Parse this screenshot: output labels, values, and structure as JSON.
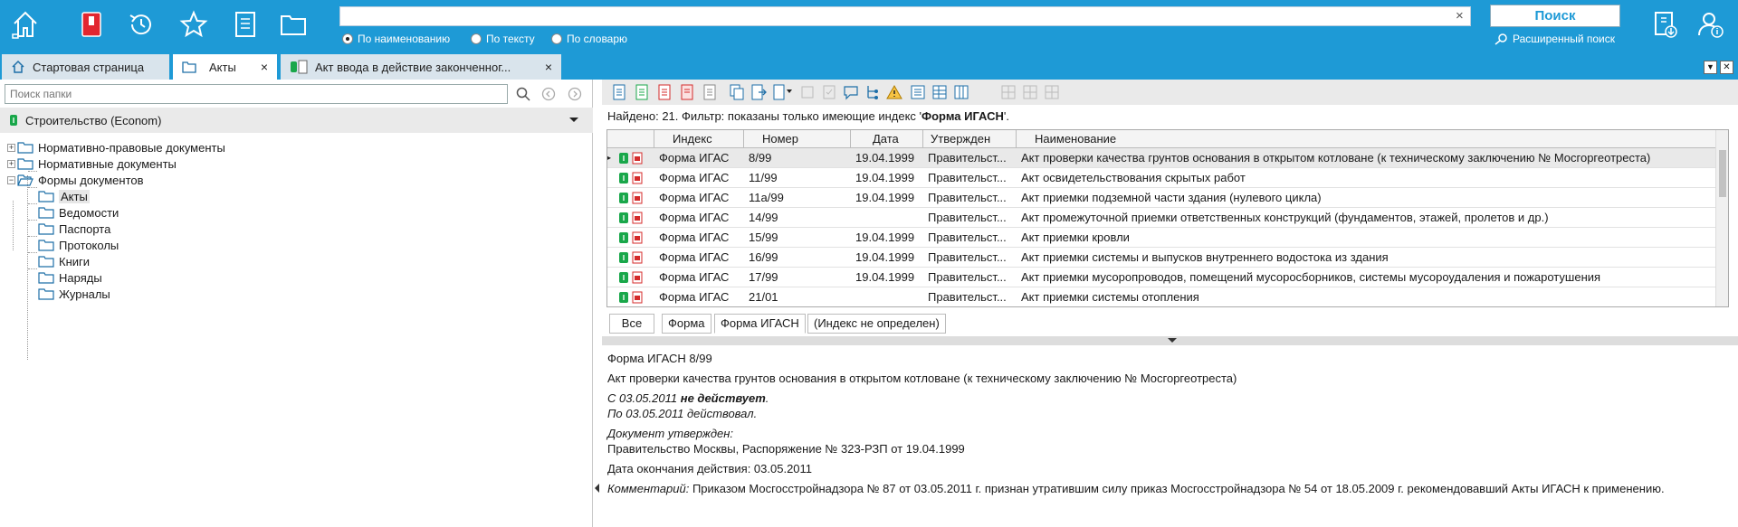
{
  "toolbar": {
    "icons": [
      "home-icon",
      "bookmark-book-icon",
      "history-icon",
      "favorites-star-icon",
      "document-icon",
      "folder-icon"
    ],
    "search_value": "",
    "search_clear": "×",
    "search_modes": [
      {
        "label": "По наименованию",
        "selected": true
      },
      {
        "label": "По тексту",
        "selected": false
      },
      {
        "label": "По словарю",
        "selected": false
      }
    ],
    "search_button": "Поиск",
    "advanced_search": "Расширенный поиск",
    "right_icons": [
      "document-download-icon",
      "user-info-icon"
    ],
    "accent_color": "#1e9ad6"
  },
  "tabs": [
    {
      "label": "Стартовая страница",
      "icon": "home-icon",
      "active": false
    },
    {
      "label": "Акты",
      "icon": "folder-icon",
      "active": true,
      "close": "×"
    },
    {
      "label": "Акт ввода в действие законченног...",
      "icon": "document-icon",
      "active": false,
      "close": "×"
    }
  ],
  "left": {
    "search_placeholder": "Поиск папки",
    "database": "Строительство (Econom)",
    "tree": [
      {
        "label": "Нормативно-правовые документы",
        "level": 0,
        "expander": "+"
      },
      {
        "label": "Нормативные документы",
        "level": 0,
        "expander": "+"
      },
      {
        "label": "Формы документов",
        "level": 0,
        "expander": "−"
      },
      {
        "label": "Акты",
        "level": 1,
        "selected": true
      },
      {
        "label": "Ведомости",
        "level": 1
      },
      {
        "label": "Паспорта",
        "level": 1
      },
      {
        "label": "Протоколы",
        "level": 1
      },
      {
        "label": "Книги",
        "level": 1
      },
      {
        "label": "Наряды",
        "level": 1
      },
      {
        "label": "Журналы",
        "level": 1
      }
    ]
  },
  "right": {
    "found_prefix": "Найдено: 21. Фильтр: показаны только имеющие индекс '",
    "found_filter": "Форма ИГАСН",
    "found_suffix": "'.",
    "columns": [
      "Индекс",
      "Номер",
      "Дата",
      "Утвержден",
      "Наименование"
    ],
    "rows": [
      {
        "index": "Форма ИГАС",
        "number": "8/99",
        "date": "19.04.1999",
        "approved": "Правительст...",
        "name": "Акт проверки качества грунтов основания в открытом котловане (к техническому заключению № Мосгоргеотреста)",
        "selected": true
      },
      {
        "index": "Форма ИГАС",
        "number": "11/99",
        "date": "19.04.1999",
        "approved": "Правительст...",
        "name": "Акт освидетельствования скрытых работ"
      },
      {
        "index": "Форма ИГАС",
        "number": "11а/99",
        "date": "19.04.1999",
        "approved": "Правительст...",
        "name": "Акт приемки подземной части здания (нулевого цикла)"
      },
      {
        "index": "Форма ИГАС",
        "number": "14/99",
        "date": "",
        "approved": "Правительст...",
        "name": "Акт промежуточной приемки ответственных конструкций (фундаментов, этажей, пролетов и др.)"
      },
      {
        "index": "Форма ИГАС",
        "number": "15/99",
        "date": "19.04.1999",
        "approved": "Правительст...",
        "name": "Акт приемки кровли"
      },
      {
        "index": "Форма ИГАС",
        "number": "16/99",
        "date": "19.04.1999",
        "approved": "Правительст...",
        "name": "Акт приемки системы и выпусков внутреннего водостока из здания"
      },
      {
        "index": "Форма ИГАС",
        "number": "17/99",
        "date": "19.04.1999",
        "approved": "Правительст...",
        "name": "Акт приемки мусоропроводов, помещений мусоросборников, системы мусороудаления и пожаротушения"
      },
      {
        "index": "Форма ИГАС",
        "number": "21/01",
        "date": "",
        "approved": "Правительст...",
        "name": "Акт приемки системы отопления"
      }
    ],
    "filter_tabs": [
      "Все",
      "Форма",
      "Форма ИГАСН",
      "(Индекс не определен)"
    ],
    "details": {
      "title": "Форма ИГАСН 8/99",
      "name": "Акт проверки качества грунтов основания в открытом котловане (к техническому заключению № Мосгоргеотреста)",
      "status_prefix": "С 03.05.2011 ",
      "status_bold": "не действует",
      "status_suffix": ".",
      "valid_until": "По 03.05.2011 действовал.",
      "approved_label": "Документ утвержден:",
      "approved_value": "Правительство Москвы, Распоряжение № 323-РЗП от 19.04.1999",
      "end_date": "Дата окончания действия: 03.05.2011",
      "comment_label": "Комментарий:",
      "comment_text": " Приказом Мосгосстройнадзора № 87 от 03.05.2011 г. признан утратившим силу приказ Мосгосстройнадзора № 54 от 18.05.2009 г. рекомендовавший Акты ИГАСН к применению."
    }
  }
}
